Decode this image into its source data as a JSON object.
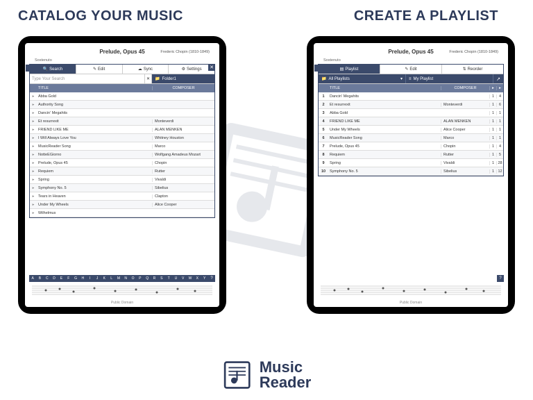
{
  "headlines": {
    "left": "CATALOG YOUR MUSIC",
    "right": "CREATE A PLAYLIST"
  },
  "score": {
    "title": "Prelude, Opus 45",
    "composer": "Frederic Chopin (1810-1849)",
    "tempo": "Sostenuto",
    "footer": "Public Domain"
  },
  "catalog": {
    "tabs": {
      "search": "Search",
      "edit": "Edit",
      "sync": "Sync",
      "settings": "Settings"
    },
    "search_placeholder": "Type Your Search",
    "folder_label": "Folder1",
    "columns": {
      "title": "TITLE",
      "composer": "COMPOSER"
    },
    "rows": [
      {
        "title": "Abba Gold",
        "composer": ""
      },
      {
        "title": "Authority Song",
        "composer": ""
      },
      {
        "title": "Dancin' Megahits",
        "composer": ""
      },
      {
        "title": "Et resurrexit",
        "composer": "Monteverdi"
      },
      {
        "title": "FRIEND LIKE ME",
        "composer": "ALAN MENKEN"
      },
      {
        "title": "I Will Always Love You",
        "composer": "Whitney Houston"
      },
      {
        "title": "MusicReader Song",
        "composer": "Marco"
      },
      {
        "title": "NotteEGiorno",
        "composer": "Wolfgang Amadeus Mozart"
      },
      {
        "title": "Prelude, Opus 45",
        "composer": "Chopin"
      },
      {
        "title": "Requiem",
        "composer": "Rutter"
      },
      {
        "title": "Spring",
        "composer": "Vivaldi"
      },
      {
        "title": "Symphony No. 5",
        "composer": "Sibelius"
      },
      {
        "title": "Tears in Heaven",
        "composer": "Clapton"
      },
      {
        "title": "Under My Wheels",
        "composer": "Alice Cooper"
      },
      {
        "title": "Wilhelmus",
        "composer": ""
      }
    ],
    "alphabet": [
      "A",
      "B",
      "C",
      "D",
      "E",
      "F",
      "G",
      "H",
      "I",
      "J",
      "K",
      "L",
      "M",
      "N",
      "O",
      "P",
      "Q",
      "R",
      "S",
      "T",
      "U",
      "V",
      "W",
      "X",
      "Y",
      "Z"
    ]
  },
  "playlist": {
    "tabs": {
      "playlist": "Playlist",
      "edit": "Edit",
      "reorder": "Reorder"
    },
    "selectors": {
      "all": "All Playlists",
      "mine": "My Playlist"
    },
    "columns": {
      "title": "TITLE",
      "composer": "COMPOSER"
    },
    "rows": [
      {
        "n": "1",
        "title": "Dancin' Megahits",
        "composer": "",
        "a": "1",
        "b": "4"
      },
      {
        "n": "2",
        "title": "Et resurrexit",
        "composer": "Monteverdi",
        "a": "1",
        "b": "6"
      },
      {
        "n": "3",
        "title": "Abba Gold",
        "composer": "",
        "a": "1",
        "b": "1"
      },
      {
        "n": "4",
        "title": "FRIEND LIKE ME",
        "composer": "ALAN MENKEN",
        "a": "1",
        "b": "1"
      },
      {
        "n": "5",
        "title": "Under My Wheels",
        "composer": "Alice Cooper",
        "a": "1",
        "b": "1"
      },
      {
        "n": "6",
        "title": "MusicReader Song",
        "composer": "Marco",
        "a": "1",
        "b": "1"
      },
      {
        "n": "7",
        "title": "Prelude, Opus 45",
        "composer": "Chopin",
        "a": "1",
        "b": "4"
      },
      {
        "n": "8",
        "title": "Requiem",
        "composer": "Rutter",
        "a": "1",
        "b": "5"
      },
      {
        "n": "9",
        "title": "Spring",
        "composer": "Vivaldi",
        "a": "1",
        "b": "28"
      },
      {
        "n": "10",
        "title": "Symphony No. 5",
        "composer": "Sibelius",
        "a": "1",
        "b": "12"
      }
    ]
  },
  "brand": {
    "line1": "Music",
    "line2": "Reader"
  }
}
